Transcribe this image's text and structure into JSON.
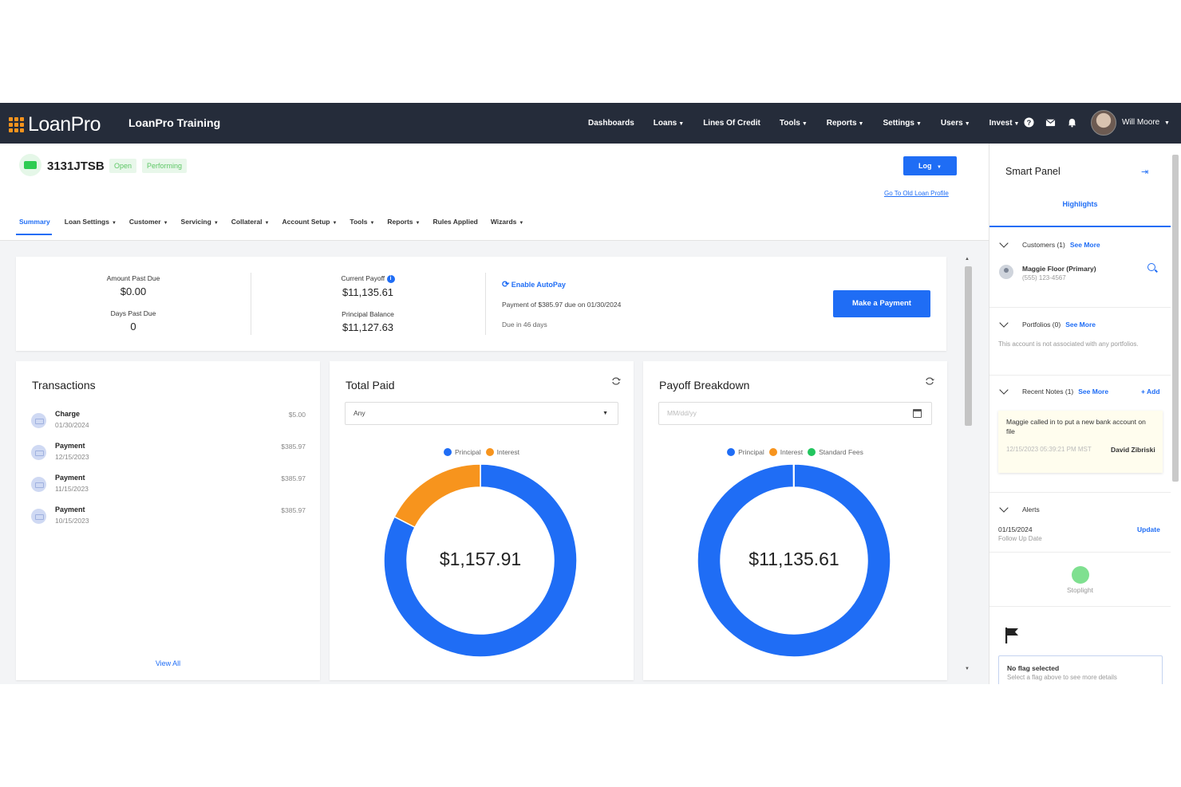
{
  "brand": {
    "logo_text": "LoanPro",
    "company": "LoanPro Training"
  },
  "nav": {
    "items": [
      {
        "label": "Dashboards",
        "dropdown": false
      },
      {
        "label": "Loans",
        "dropdown": true
      },
      {
        "label": "Lines Of Credit",
        "dropdown": false
      },
      {
        "label": "Tools",
        "dropdown": true
      },
      {
        "label": "Reports",
        "dropdown": true
      },
      {
        "label": "Settings",
        "dropdown": true
      },
      {
        "label": "Users",
        "dropdown": true
      },
      {
        "label": "Invest",
        "dropdown": true
      }
    ],
    "icons": [
      "help-icon",
      "mail-icon",
      "bell-icon"
    ],
    "user_name": "Will Moore"
  },
  "loan": {
    "id": "3131JTSB",
    "status_badge": "Open",
    "sub_status_badge": "Performing",
    "log_button": "Log",
    "old_profile_link": "Go To Old Loan Profile"
  },
  "tabs": [
    "Summary",
    "Loan Settings",
    "Customer",
    "Servicing",
    "Collateral",
    "Account Setup",
    "Tools",
    "Reports",
    "Rules Applied",
    "Wizards"
  ],
  "tab_dropdowns": [
    false,
    true,
    true,
    true,
    true,
    true,
    true,
    true,
    false,
    true
  ],
  "summary": {
    "amount_past_due_label": "Amount Past Due",
    "amount_past_due": "$0.00",
    "days_past_due_label": "Days Past Due",
    "days_past_due": "0",
    "current_payoff_label": "Current Payoff",
    "current_payoff": "$11,135.61",
    "principal_balance_label": "Principal Balance",
    "principal_balance": "$11,127.63",
    "autopay_link": "Enable AutoPay",
    "payment_info": "Payment of $385.97 due on 01/30/2024",
    "due_in": "Due in 46 days",
    "make_payment_button": "Make a Payment"
  },
  "transactions": {
    "title": "Transactions",
    "rows": [
      {
        "type": "Charge",
        "date": "01/30/2024",
        "amount": "$5.00"
      },
      {
        "type": "Payment",
        "date": "12/15/2023",
        "amount": "$385.97"
      },
      {
        "type": "Payment",
        "date": "11/15/2023",
        "amount": "$385.97"
      },
      {
        "type": "Payment",
        "date": "10/15/2023",
        "amount": "$385.97"
      }
    ],
    "view_all": "View All"
  },
  "total_paid": {
    "title": "Total Paid",
    "filter_value": "Any",
    "center_value": "$1,157.91"
  },
  "payoff_breakdown": {
    "title": "Payoff Breakdown",
    "date_placeholder": "MM/dd/yy",
    "center_value": "$11,135.61"
  },
  "chart_data": [
    {
      "type": "pie",
      "title": "Total Paid",
      "categories": [
        "Principal",
        "Interest"
      ],
      "values": [
        0.825,
        0.175
      ],
      "colors": [
        "#1f6df5",
        "#f7941d"
      ],
      "total_label": "$1,157.91",
      "legend": "top"
    },
    {
      "type": "pie",
      "title": "Payoff Breakdown",
      "categories": [
        "Principal",
        "Interest",
        "Standard Fees"
      ],
      "values": [
        0.9993,
        0.0003,
        0.0004
      ],
      "colors": [
        "#1f6df5",
        "#f7941d",
        "#22c55e"
      ],
      "total_label": "$11,135.61",
      "legend": "top"
    }
  ],
  "smart_panel": {
    "title": "Smart Panel",
    "tab": "Highlights",
    "customers_header": "Customers (1)",
    "customers_link": "See More",
    "customer_name": "Maggie Floor (Primary)",
    "customer_phone": "(555) 123-4567",
    "portfolios_header": "Portfolios (0)",
    "portfolios_link": "See More",
    "portfolios_empty": "This account is not associated with any portfolios.",
    "notes_header": "Recent Notes (1)",
    "notes_link": "See More",
    "notes_add": "+ Add",
    "note_text": "Maggie called in to put a new bank account on file",
    "note_time": "12/15/2023 05:39:21 PM MST",
    "note_author": "David Zibriski",
    "alerts_header": "Alerts",
    "alert_date": "01/15/2024",
    "alert_type": "Follow Up Date",
    "alert_update": "Update",
    "stoplight_label": "Stoplight",
    "stoplight_color": "#7fe090",
    "flag_title": "No flag selected",
    "flag_subtitle": "Select a flag above to see more details"
  }
}
